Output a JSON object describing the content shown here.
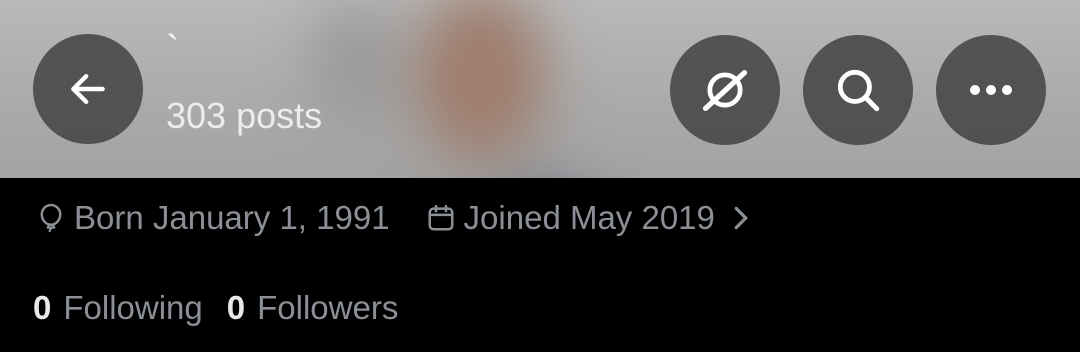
{
  "header": {
    "name": "`",
    "post_count": "303 posts",
    "banner_colors": {
      "background": "#b0b0b0",
      "skin": "#a77c68",
      "shirt": "#4c5d72"
    }
  },
  "buttons": {
    "back": {
      "icon": "arrow-left-icon"
    },
    "grok": {
      "icon": "grok-icon"
    },
    "search": {
      "icon": "search-icon"
    },
    "more": {
      "icon": "more-horizontal-icon"
    }
  },
  "profile_meta": {
    "birthday": "Born January 1, 1991",
    "joined": "Joined May 2019",
    "birthday_icon": "balloon-icon",
    "joined_icon": "calendar-icon",
    "expand_icon": "chevron-right-icon"
  },
  "stats": {
    "following_count": "0",
    "following_label": "Following",
    "followers_count": "0",
    "followers_label": "Followers"
  },
  "colors": {
    "background": "#000000",
    "primary_text": "#e7e9ea",
    "secondary_text": "#8b9096",
    "button_bg": "#464646"
  }
}
